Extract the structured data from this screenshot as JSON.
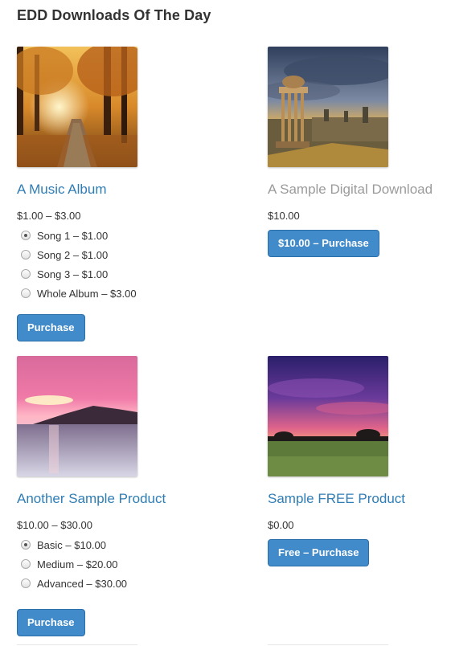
{
  "section": {
    "title": "EDD Downloads Of The Day"
  },
  "products": [
    {
      "title": "A Music Album",
      "image": "autumn-forest-path-image",
      "price": "$1.00 – $3.00",
      "options": [
        {
          "label": "Song 1 – $1.00",
          "selected": true
        },
        {
          "label": "Song 2 – $1.00",
          "selected": false
        },
        {
          "label": "Song 3 – $1.00",
          "selected": false
        },
        {
          "label": "Whole Album – $3.00",
          "selected": false
        }
      ],
      "button": "Purchase"
    },
    {
      "title": "A Sample Digital Download",
      "image": "city-monument-image",
      "price": "$10.00",
      "button": "$10.00 – Purchase"
    },
    {
      "title": "Another Sample Product",
      "image": "pink-sunset-sea-image",
      "price": "$10.00 – $30.00",
      "options": [
        {
          "label": "Basic – $10.00",
          "selected": true
        },
        {
          "label": "Medium – $20.00",
          "selected": false
        },
        {
          "label": "Advanced – $30.00",
          "selected": false
        }
      ],
      "button": "Purchase"
    },
    {
      "title": "Sample FREE Product",
      "image": "purple-sky-meadow-image",
      "price": "$0.00",
      "button": "Free – Purchase"
    }
  ],
  "colors": {
    "link": "#2f7db5",
    "link_muted": "#9b9b9b",
    "button": "#428bca"
  }
}
